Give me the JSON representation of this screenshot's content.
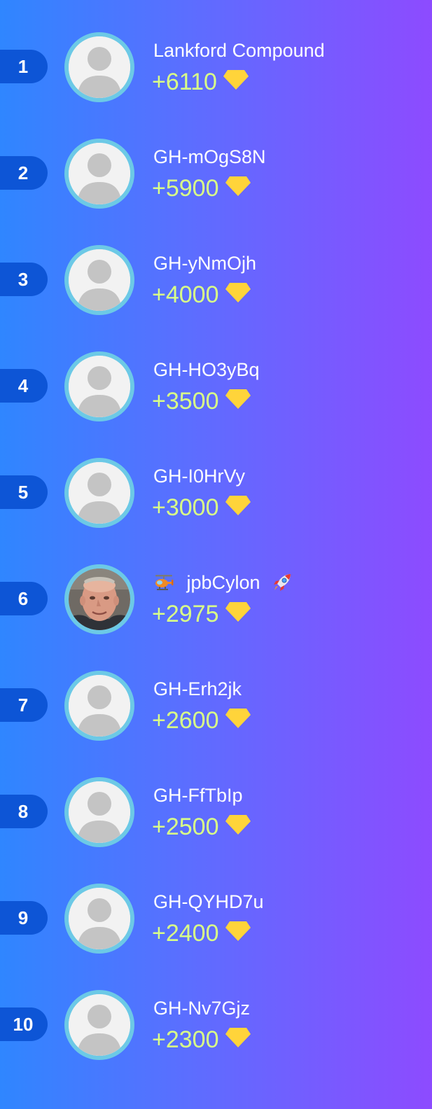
{
  "leaderboard": {
    "accent": "#0d55d6",
    "avatar_ring": "#6cc9e6",
    "score_color": "#d9ff87",
    "gem_color": "#ffd43a",
    "entries": [
      {
        "rank": "1",
        "name": "Lankford Compound",
        "score": "+6110",
        "avatar": "default-avatar-icon"
      },
      {
        "rank": "2",
        "name": "GH-mOgS8N",
        "score": "+5900",
        "avatar": "default-avatar-icon"
      },
      {
        "rank": "3",
        "name": "GH-yNmOjh",
        "score": "+4000",
        "avatar": "default-avatar-icon"
      },
      {
        "rank": "4",
        "name": "GH-HO3yBq",
        "score": "+3500",
        "avatar": "default-avatar-icon"
      },
      {
        "rank": "5",
        "name": "GH-I0HrVy",
        "score": "+3000",
        "avatar": "default-avatar-icon"
      },
      {
        "rank": "6",
        "name": "jpbCylon",
        "name_prefix_icon": "helicopter-emoji-icon",
        "name_suffix_icon": "rocket-emoji-icon",
        "score": "+2975",
        "avatar": "user-photo"
      },
      {
        "rank": "7",
        "name": "GH-Erh2jk",
        "score": "+2600",
        "avatar": "default-avatar-icon"
      },
      {
        "rank": "8",
        "name": "GH-FfTbIp",
        "score": "+2500",
        "avatar": "default-avatar-icon"
      },
      {
        "rank": "9",
        "name": "GH-QYHD7u",
        "score": "+2400",
        "avatar": "default-avatar-icon"
      },
      {
        "rank": "10",
        "name": "GH-Nv7Gjz",
        "score": "+2300",
        "avatar": "default-avatar-icon"
      }
    ]
  }
}
